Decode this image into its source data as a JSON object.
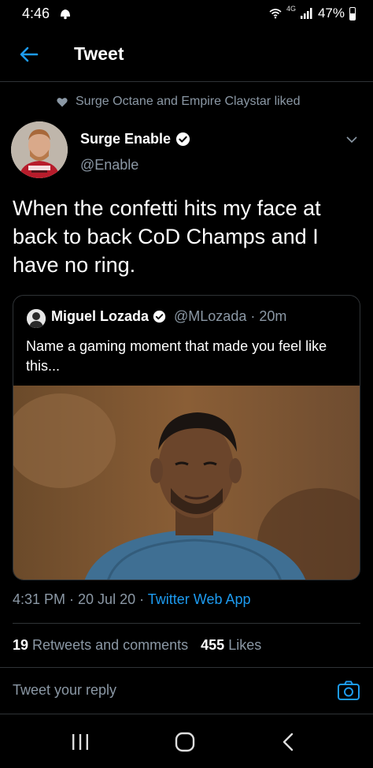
{
  "status_bar": {
    "time": "4:46",
    "network": "4G",
    "battery": "47%"
  },
  "header": {
    "title": "Tweet",
    "back_icon": "arrow-left-icon"
  },
  "social_context": {
    "text": "Surge Octane and Empire Claystar liked",
    "icon": "heart-icon"
  },
  "tweet": {
    "author_name": "Surge Enable",
    "author_handle": "@Enable",
    "text": "When the confetti hits my face at back to back CoD Champs and I have no ring.",
    "timestamp": "4:31 PM · 20 Jul 20 · ",
    "source": "Twitter Web App",
    "retweets_count": "19",
    "retweets_label": "Retweets and comments",
    "likes_count": "455",
    "likes_label": "Likes"
  },
  "quoted_tweet": {
    "author_name": "Miguel Lozada",
    "author_handle": "@MLozada · 20m",
    "text": "Name a gaming moment that made you feel like this..."
  },
  "reply": {
    "placeholder": "Tweet your reply"
  },
  "colors": {
    "accent": "#1d9bf0",
    "background": "#000000",
    "secondary_text": "#8b98a5",
    "border": "#2f3336"
  }
}
